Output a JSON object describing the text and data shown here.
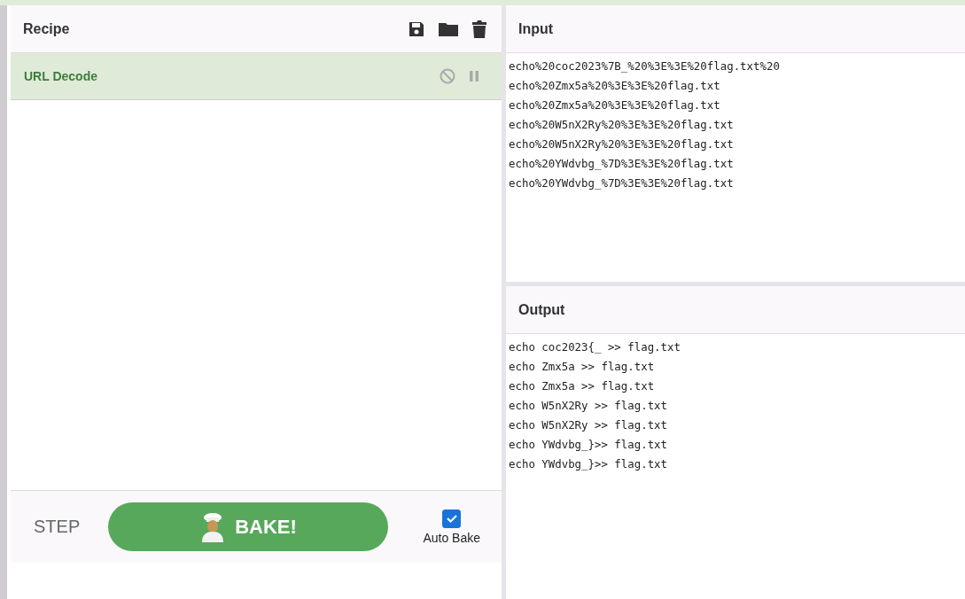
{
  "recipe": {
    "title": "Recipe",
    "operations": [
      {
        "name": "URL Decode",
        "disabled": false,
        "paused": false
      }
    ]
  },
  "controls": {
    "step": "STEP",
    "bake": "BAKE!",
    "auto_bake": {
      "label": "Auto Bake",
      "checked": true
    }
  },
  "input": {
    "title": "Input",
    "lines": [
      "echo%20coc2023%7B_%20%3E%3E%20flag.txt%20",
      "echo%20Zmx5a%20%3E%3E%20flag.txt",
      "echo%20Zmx5a%20%3E%3E%20flag.txt",
      "echo%20W5nX2Ry%20%3E%3E%20flag.txt",
      "echo%20W5nX2Ry%20%3E%3E%20flag.txt",
      "echo%20YWdvbg_%7D%3E%3E%20flag.txt",
      "echo%20YWdvbg_%7D%3E%3E%20flag.txt"
    ]
  },
  "output": {
    "title": "Output",
    "lines": [
      "echo coc2023{_ >> flag.txt",
      "echo Zmx5a >> flag.txt",
      "echo Zmx5a >> flag.txt",
      "echo W5nX2Ry >> flag.txt",
      "echo W5nX2Ry >> flag.txt",
      "echo YWdvbg_}>> flag.txt",
      "echo YWdvbg_}>> flag.txt"
    ]
  }
}
